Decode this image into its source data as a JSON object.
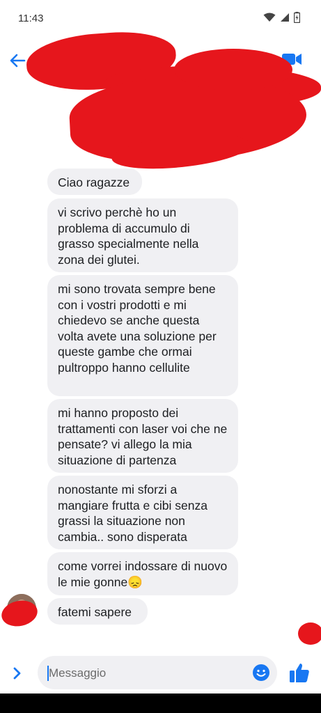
{
  "status_bar": {
    "time": "11:43"
  },
  "conversation": {
    "messages": [
      {
        "text": "Ciao ragazze"
      },
      {
        "text": "vi scrivo perchè ho un problema di accumulo di grasso specialmente nella zona dei glutei."
      },
      {
        "text": "mi sono trovata sempre bene con i vostri prodotti e mi chiedevo se anche questa volta avete una soluzione per queste gambe che ormai pultroppo hanno cellulite"
      },
      {
        "text": "mi hanno proposto dei trattamenti con laser voi che ne pensate? vi allego la mia situazione di partenza"
      },
      {
        "text": "nonostante mi sforzi a mangiare frutta e cibi senza grassi la situazione non cambia.. sono disperata"
      },
      {
        "text": "come vorrei indossare di nuovo le mie gonne😞"
      },
      {
        "text": "fatemi sapere"
      }
    ]
  },
  "composer": {
    "placeholder": "Messaggio"
  },
  "colors": {
    "accent": "#1877f2",
    "redaction": "#e6161c",
    "bubble": "#f0f0f3"
  },
  "icons": {
    "back": "arrow-left-icon",
    "call": "phone-icon",
    "video": "video-camera-icon",
    "expand": "chevron-right-icon",
    "emoji": "smiley-icon",
    "like": "thumbs-up-icon"
  }
}
